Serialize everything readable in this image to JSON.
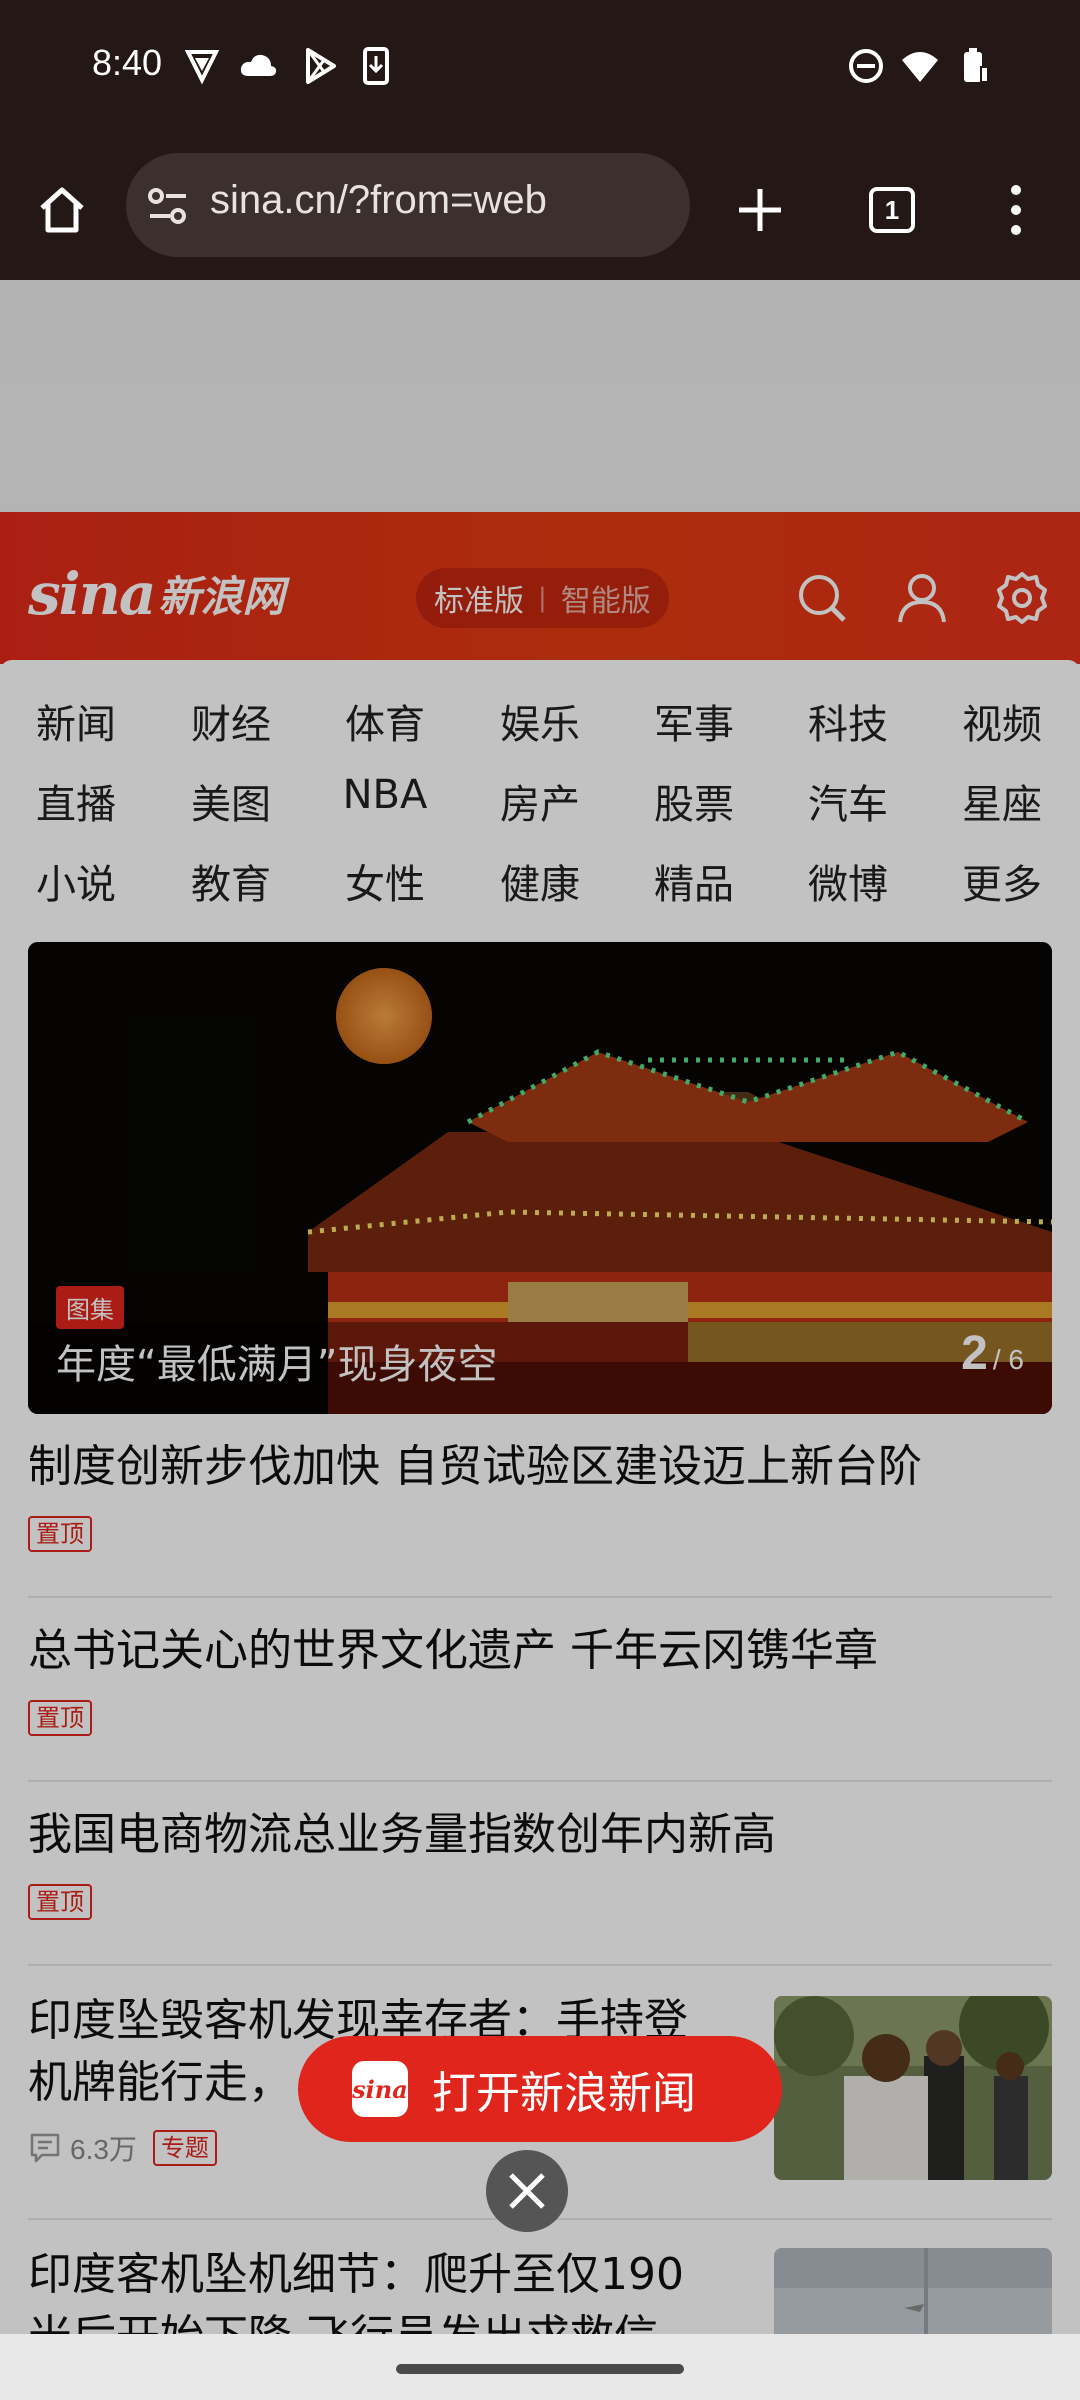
{
  "status_bar": {
    "time": "8:40"
  },
  "browser": {
    "url": "sina.cn/?from=web",
    "tab_count": "1"
  },
  "sina": {
    "logo_text": "sina",
    "logo_cn": "新浪网",
    "version_standard": "标准版",
    "version_smart": "智能版",
    "brand_color": "#e0251c"
  },
  "nav": {
    "rows": [
      [
        "新闻",
        "财经",
        "体育",
        "娱乐",
        "军事",
        "科技",
        "视频"
      ],
      [
        "直播",
        "美图",
        "NBA",
        "房产",
        "股票",
        "汽车",
        "星座"
      ],
      [
        "小说",
        "教育",
        "女性",
        "健康",
        "精品",
        "微博",
        "更多"
      ]
    ]
  },
  "hero": {
    "tag": "图集",
    "title": "年度“最低满月”现身夜空",
    "current": "2",
    "total": "/ 6"
  },
  "news": [
    {
      "title": "制度创新步伐加快 自贸试验区建设迈上新台阶",
      "tag": "置顶"
    },
    {
      "title": "总书记关心的世界文化遗产 千年云冈镌华章",
      "tag": "置顶"
    },
    {
      "title": "我国电商物流总业务量指数创年内新高",
      "tag": "置顶"
    },
    {
      "title_line1": "印度坠毁客机发现幸存者：手持登",
      "title_line2": "机牌能行走，",
      "comments": "6.3万",
      "tag": "专题"
    },
    {
      "title_line1": "印度客机坠机细节：爬升至仅190",
      "title_line2": "米后开始下降 飞行员发出求救信"
    }
  ],
  "open_app": {
    "logo": "sina",
    "label": "打开新浪新闻"
  }
}
